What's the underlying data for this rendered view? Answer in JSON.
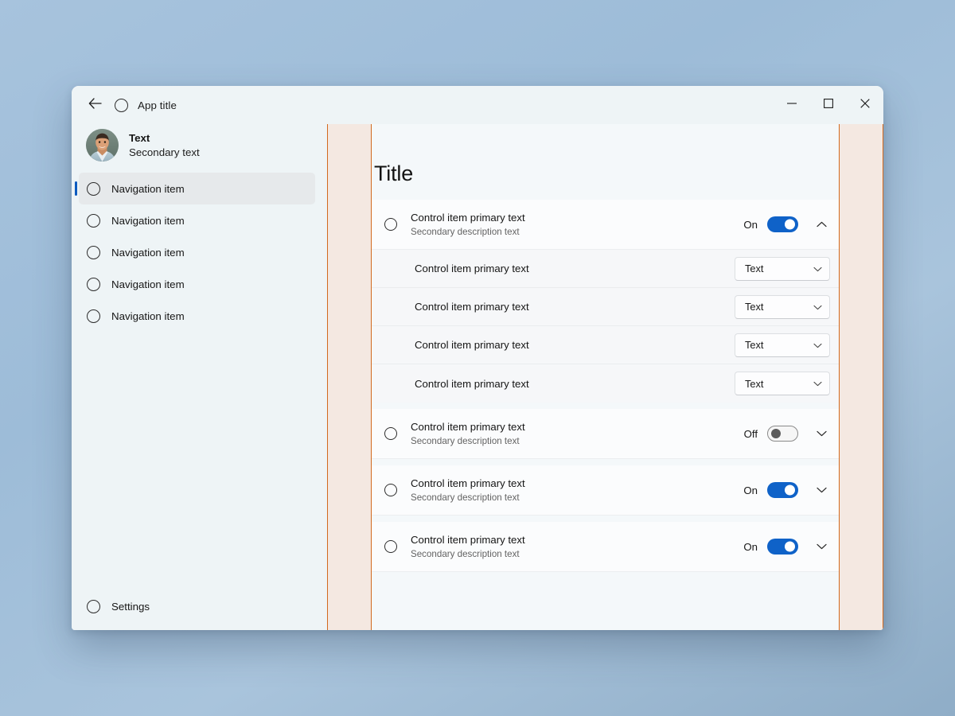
{
  "titlebar": {
    "back_icon": "arrow-left-icon",
    "app_icon": "circle-placeholder-icon",
    "title": "App title",
    "minimize_label": "—",
    "maximize_label": "□",
    "close_label": "✕"
  },
  "sidebar": {
    "profile": {
      "name": "Text",
      "secondary": "Secondary text",
      "avatar": "user-photo-avatar"
    },
    "items": [
      {
        "label": "Navigation item",
        "selected": true
      },
      {
        "label": "Navigation item",
        "selected": false
      },
      {
        "label": "Navigation item",
        "selected": false
      },
      {
        "label": "Navigation item",
        "selected": false
      },
      {
        "label": "Navigation item",
        "selected": false
      }
    ],
    "settings": {
      "label": "Settings"
    }
  },
  "content": {
    "title": "Title",
    "groups": [
      {
        "header": {
          "primary": "Control item primary text",
          "secondary": "Secondary description text",
          "toggle_state": "On",
          "toggle_on": true,
          "expanded": true,
          "chevron": "chevron-up-icon"
        },
        "subitems": [
          {
            "primary": "Control item primary text",
            "combo_value": "Text"
          },
          {
            "primary": "Control item primary text",
            "combo_value": "Text"
          },
          {
            "primary": "Control item primary text",
            "combo_value": "Text"
          },
          {
            "primary": "Control item primary text",
            "combo_value": "Text"
          }
        ]
      },
      {
        "header": {
          "primary": "Control item primary text",
          "secondary": "Secondary description text",
          "toggle_state": "Off",
          "toggle_on": false,
          "expanded": false,
          "chevron": "chevron-down-icon"
        },
        "subitems": []
      },
      {
        "header": {
          "primary": "Control item primary text",
          "secondary": "Secondary description text",
          "toggle_state": "On",
          "toggle_on": true,
          "expanded": false,
          "chevron": "chevron-down-icon"
        },
        "subitems": []
      },
      {
        "header": {
          "primary": "Control item primary text",
          "secondary": "Secondary description text",
          "toggle_state": "On",
          "toggle_on": true,
          "expanded": false,
          "chevron": "chevron-down-icon"
        },
        "subitems": []
      }
    ]
  },
  "colors": {
    "accent": "#0f62c8",
    "selection_indicator": "#0d5bbf",
    "band_fill": "#f4e8e1",
    "band_border": "#d2691e",
    "sidebar_bg": "#eef4f6",
    "content_bg": "#f4f8fa",
    "desktop_bg": "#a3c0da"
  }
}
